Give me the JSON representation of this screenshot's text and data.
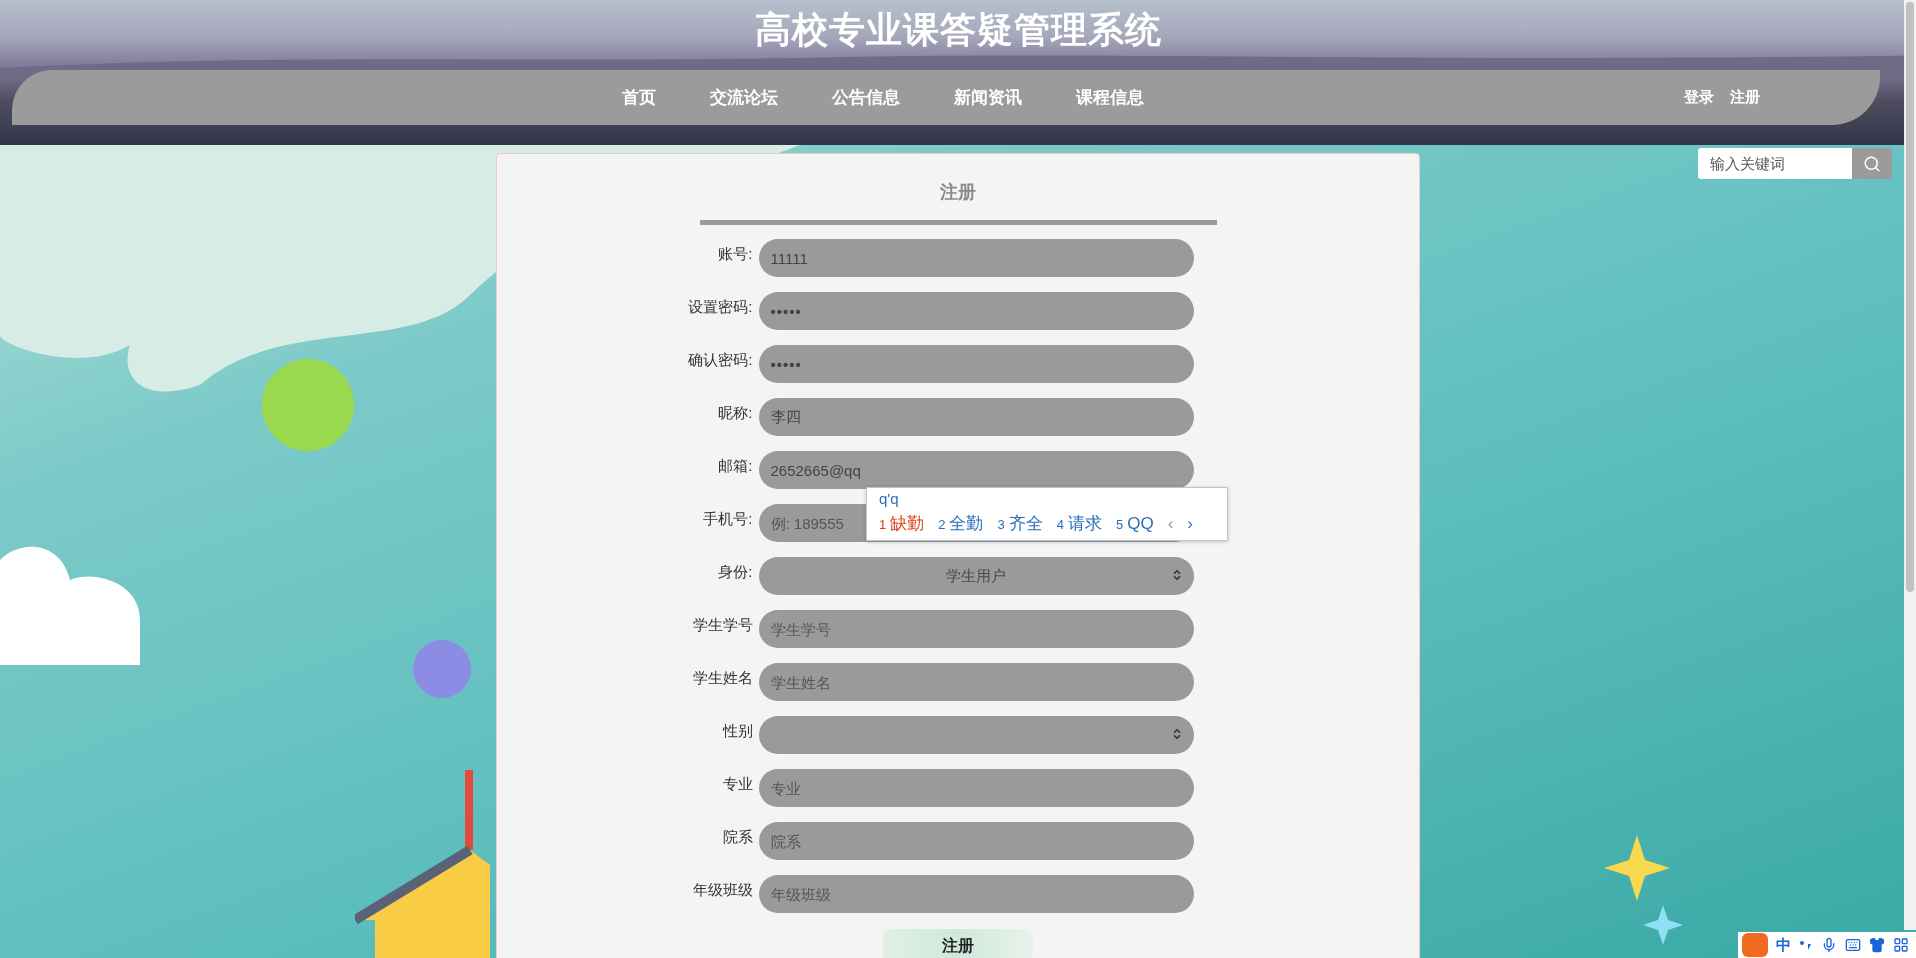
{
  "header": {
    "title": "高校专业课答疑管理系统",
    "nav": [
      {
        "label": "首页"
      },
      {
        "label": "交流论坛"
      },
      {
        "label": "公告信息"
      },
      {
        "label": "新闻资讯"
      },
      {
        "label": "课程信息"
      }
    ],
    "auth_links": [
      "登录",
      "注册"
    ]
  },
  "search": {
    "placeholder": "输入关键词"
  },
  "form": {
    "title": "注册",
    "fields": [
      {
        "label": "账号:",
        "kind": "text",
        "value": "11111"
      },
      {
        "label": "设置密码:",
        "kind": "password",
        "value": "•••••"
      },
      {
        "label": "确认密码:",
        "kind": "password",
        "value": "•••••"
      },
      {
        "label": "昵称:",
        "kind": "text",
        "value": "李四"
      },
      {
        "label": "邮箱:",
        "kind": "text",
        "value": "2652665@qq"
      },
      {
        "label": "手机号:",
        "kind": "text",
        "placeholder": "例: 189555"
      },
      {
        "label": "身份:",
        "kind": "select",
        "value": "学生用户"
      },
      {
        "label": "学生学号",
        "kind": "text",
        "placeholder": "学生学号"
      },
      {
        "label": "学生姓名",
        "kind": "text",
        "placeholder": "学生姓名"
      },
      {
        "label": "性别",
        "kind": "select"
      },
      {
        "label": "专业",
        "kind": "text",
        "placeholder": "专业"
      },
      {
        "label": "院系",
        "kind": "text",
        "placeholder": "院系"
      },
      {
        "label": "年级班级",
        "kind": "text",
        "placeholder": "年级班级"
      }
    ],
    "submit": "注册"
  },
  "ime": {
    "composition": "q'q",
    "candidates": [
      {
        "index": "1",
        "text": "缺勤",
        "selected": true
      },
      {
        "index": "2",
        "text": "全勤",
        "selected": false
      },
      {
        "index": "3",
        "text": "齐全",
        "selected": false
      },
      {
        "index": "4",
        "text": "请求",
        "selected": false
      },
      {
        "index": "5",
        "text": "QQ",
        "selected": false
      }
    ],
    "prev": "‹",
    "next": "›"
  },
  "ime_toolbar": {
    "mode": "中"
  }
}
